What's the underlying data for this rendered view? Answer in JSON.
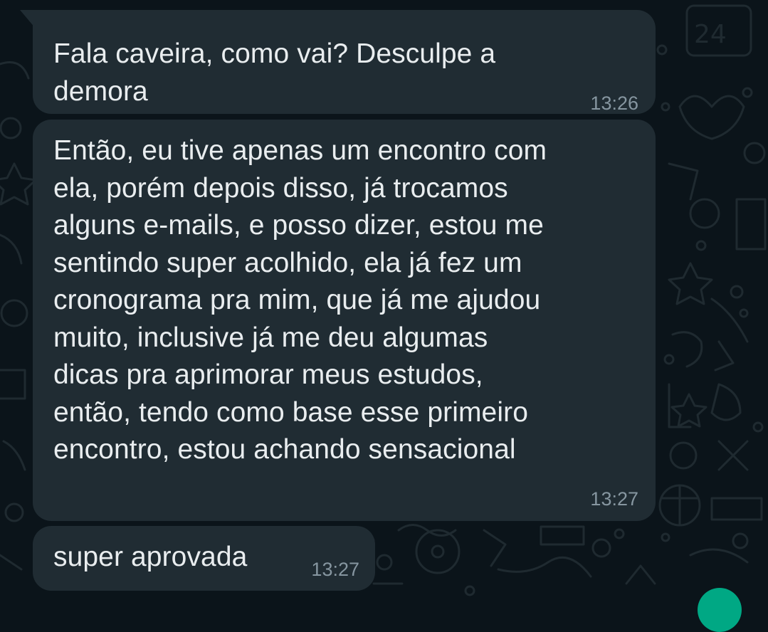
{
  "conversation": {
    "messages": [
      {
        "text": "Fala caveira, como vai? Desculpe a\ndemora",
        "time": "13:26"
      },
      {
        "text": "Então, eu tive apenas um encontro com\nela, porém depois disso, já trocamos\nalguns e-mails, e posso dizer, estou me\nsentindo super acolhido, ela já fez um\ncronograma pra mim, que já me ajudou\nmuito, inclusive já me deu algumas\ndicas pra aprimorar meus estudos,\nentão, tendo como base esse primeiro\nencontro, estou achando sensacional",
        "time": "13:27"
      },
      {
        "text": "super aprovada",
        "time": "13:27"
      }
    ]
  },
  "theme": {
    "background": "#0b141a",
    "bubble": "#202c33",
    "text": "#e9edef",
    "timestamp": "#8696a0",
    "accent": "#00a884"
  },
  "icons": [
    "wallpaper-doodle-pattern",
    "scroll-to-bottom-button"
  ]
}
